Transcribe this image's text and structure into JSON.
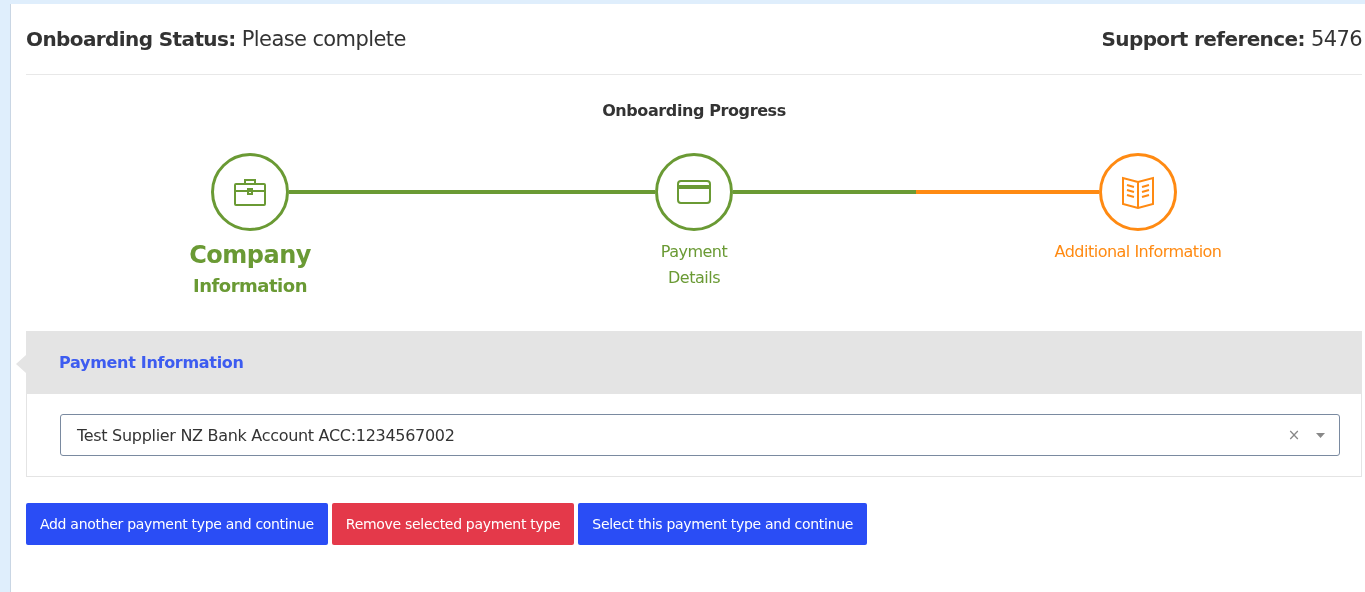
{
  "status": {
    "label": "Onboarding Status:",
    "value": "Please complete"
  },
  "support": {
    "label": "Support reference:",
    "value": "5476"
  },
  "progress": {
    "title": "Onboarding Progress",
    "steps": [
      {
        "label_lines": [
          "Company",
          "Information"
        ],
        "kind": "complete",
        "selected": true
      },
      {
        "label_lines": [
          "Payment",
          "Details"
        ],
        "kind": "complete",
        "selected": false
      },
      {
        "label_lines": [
          "Additional Information"
        ],
        "kind": "current",
        "selected": false
      }
    ]
  },
  "section": {
    "title": "Payment Information",
    "select": {
      "value": "Test Supplier NZ Bank Account ACC:1234567002",
      "clear": "×"
    }
  },
  "buttons": [
    {
      "label": "Add another payment type and continue",
      "kind": "primary"
    },
    {
      "label": "Remove selected payment type",
      "kind": "danger"
    },
    {
      "label": "Select this payment type and continue",
      "kind": "primary"
    }
  ]
}
